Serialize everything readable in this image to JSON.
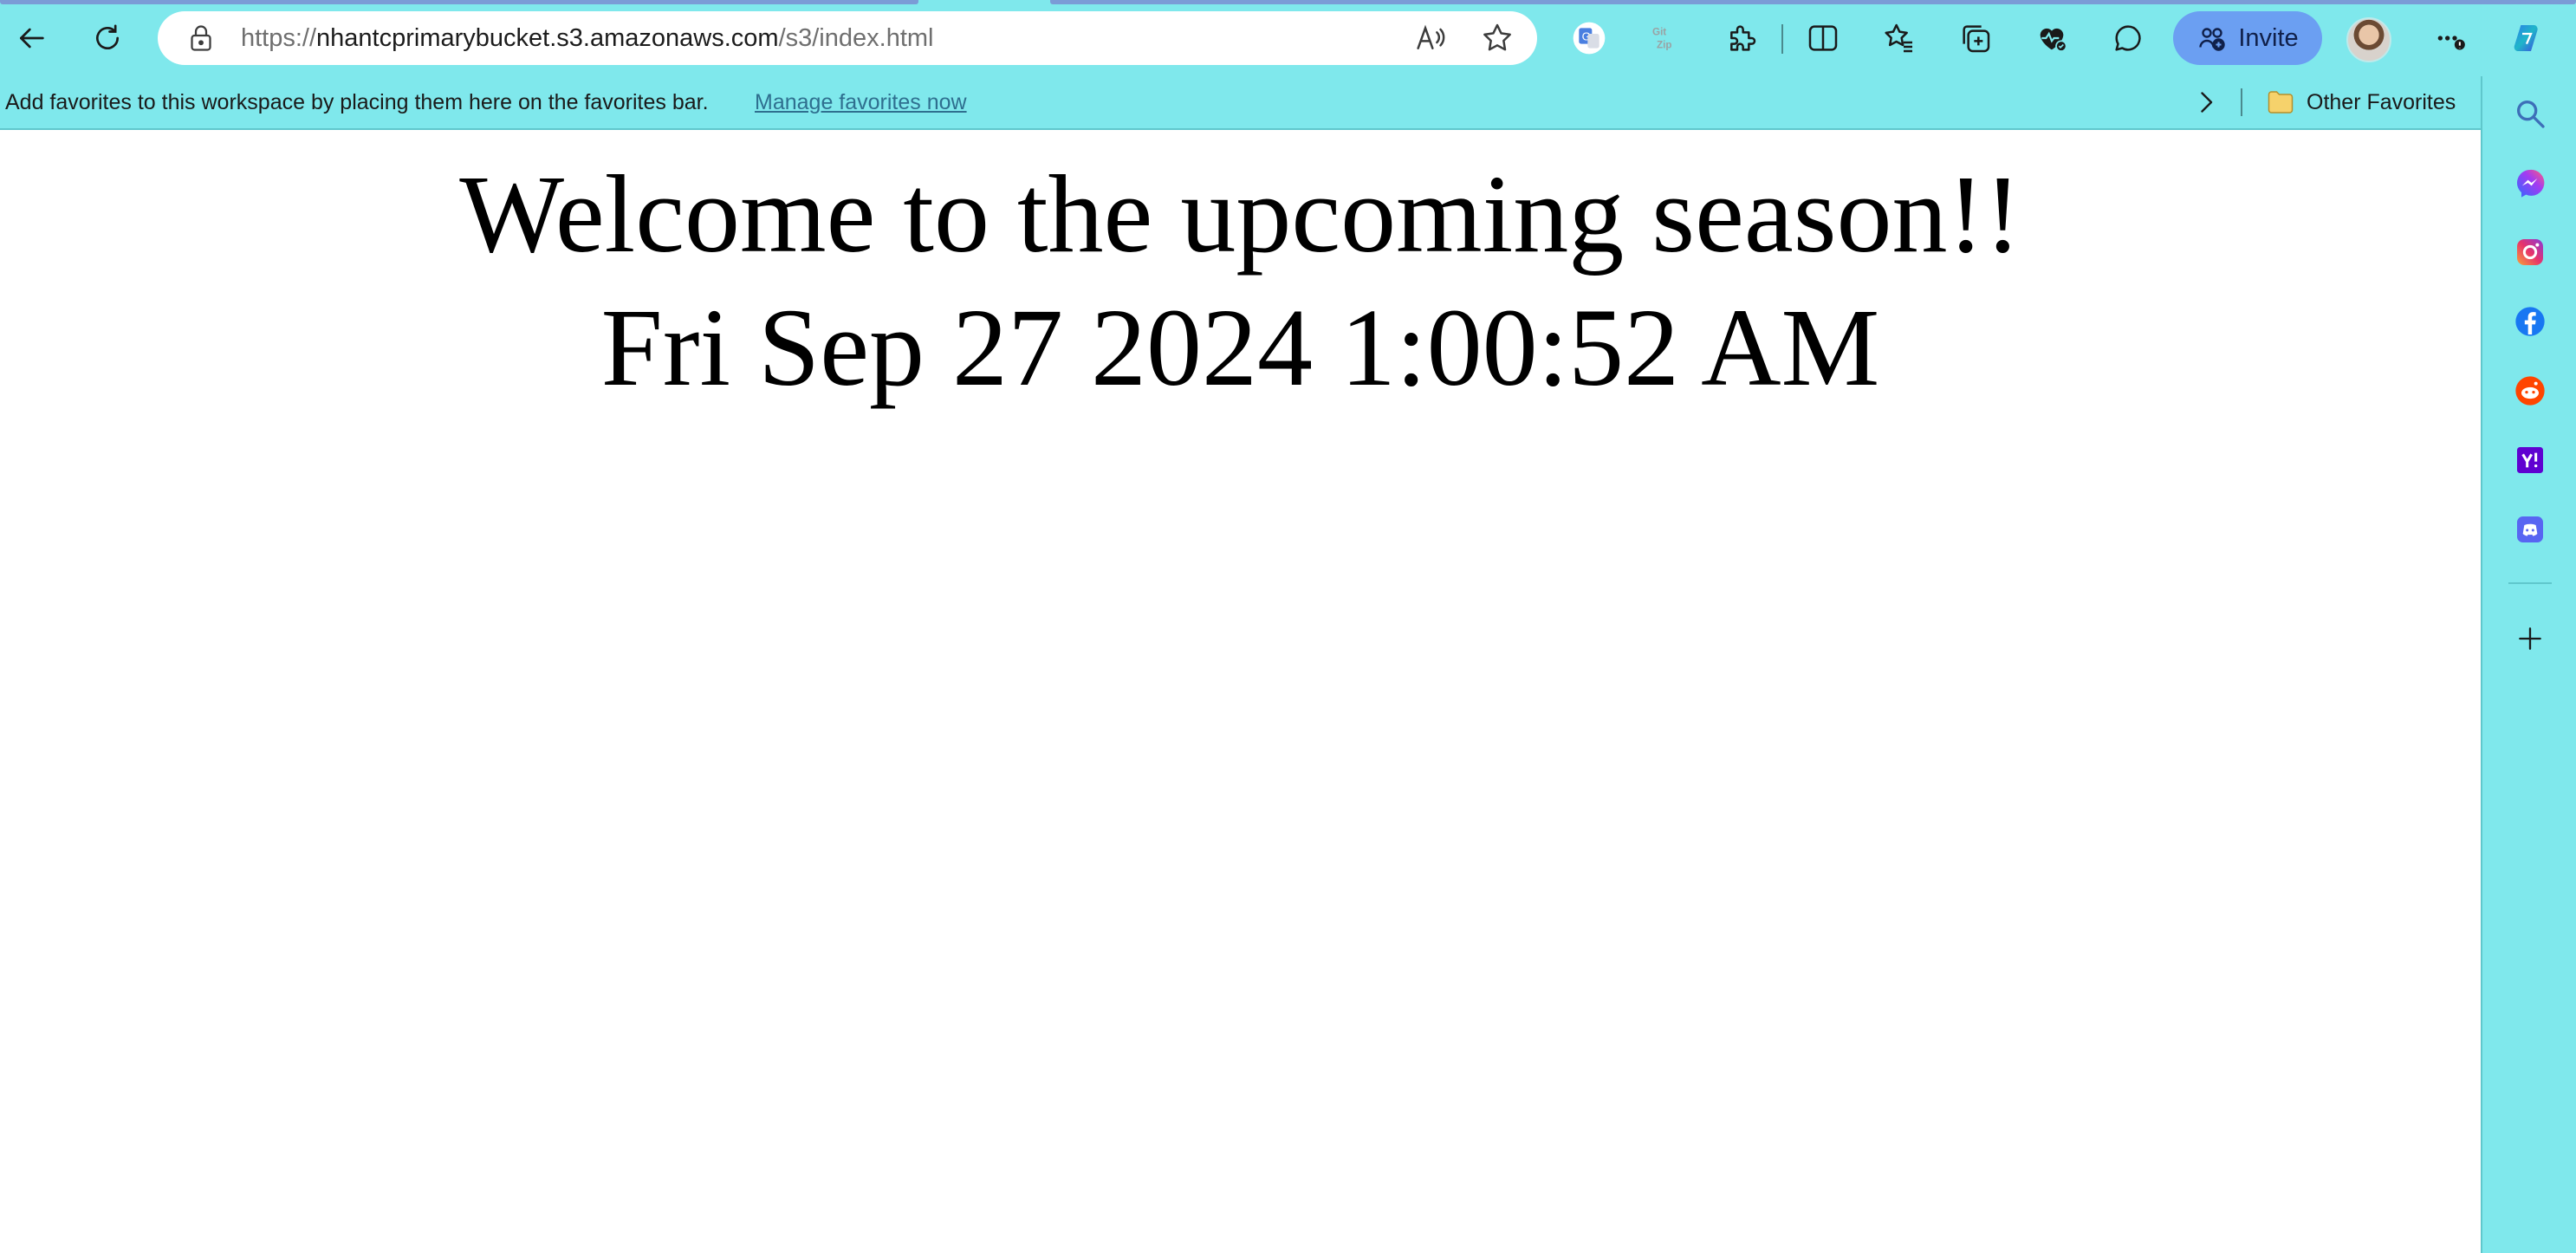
{
  "browser": {
    "url": {
      "scheme": "https://",
      "host": "nhantcprimarybucket.s3.amazonaws.com",
      "path": "/s3/index.html"
    },
    "invite_label": "Invite",
    "icons": {
      "back": "back-arrow-icon",
      "refresh": "refresh-icon",
      "lock": "lock-icon",
      "read_aloud": "read-aloud-icon",
      "favorite": "star-icon",
      "translate": "google-translate-icon",
      "gitzip": "gitzip-icon",
      "extensions": "puzzle-icon",
      "split_screen": "split-screen-icon",
      "favorites": "favorites-icon",
      "collections": "collections-icon",
      "health": "heart-health-icon",
      "feedback": "chat-icon",
      "more": "more-icon",
      "copilot": "copilot-icon"
    },
    "colors": {
      "chrome": "#7fe8ec",
      "invite": "#6b9ff2"
    }
  },
  "favorites_bar": {
    "message": "Add favorites to this workspace by placing them here on the favorites bar.",
    "manage_link": "Manage favorites now",
    "other_favorites": "Other Favorites"
  },
  "sidebar": {
    "items": [
      "search-icon",
      "messenger-icon",
      "instagram-icon",
      "facebook-icon",
      "reddit-icon",
      "yahoo-icon",
      "discord-icon",
      "add-icon"
    ]
  },
  "page": {
    "heading": "Welcome to the upcoming season!!",
    "datetime": "Fri Sep 27 2024 1:00:52 AM"
  }
}
